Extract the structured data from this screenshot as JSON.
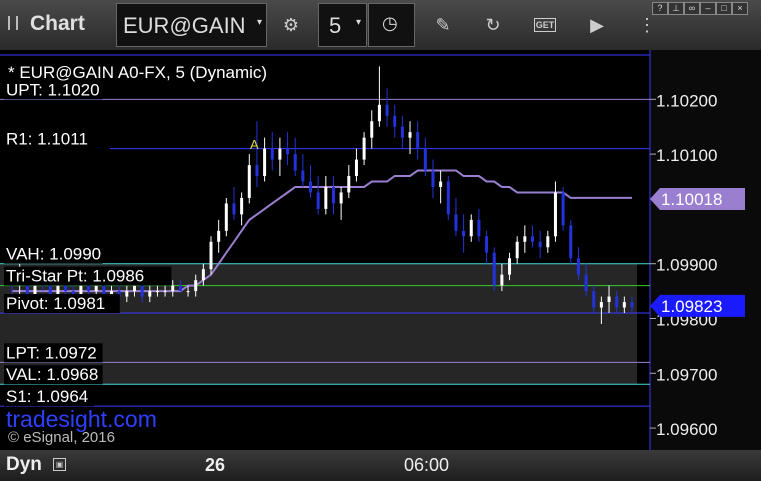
{
  "toolbar": {
    "title": "Chart",
    "symbol": "EUR@GAIN",
    "interval": "5"
  },
  "chart_header": "* EUR@GAIN A0-FX, 5 (Dynamic)",
  "watermark": "tradesight.com",
  "copyright": "© eSignal, 2016",
  "bottom": {
    "mode": "Dyn",
    "x_labels": [
      "26",
      "06:00"
    ]
  },
  "colors": {
    "background": "#000000",
    "up_candle": "#ffffff",
    "down_candle": "#2233dd",
    "moving_average": "#9a7fd0",
    "level_purple": "#9a7fd0",
    "level_blue": "#3a3aff",
    "level_cyan": "#48d8d8",
    "level_green": "#33cc33",
    "last_price_badge": "#1a1aff",
    "ma_price_badge": "#9a7fd0"
  },
  "chart_data": {
    "type": "candlestick",
    "ylim": [
      1.0956,
      1.1029
    ],
    "y_ticks": [
      "1.10200",
      "1.10100",
      "1.09900",
      "1.09800",
      "1.09700",
      "1.09600"
    ],
    "y_tick_values": [
      1.102,
      1.101,
      1.099,
      1.098,
      1.097,
      1.096
    ],
    "levels": [
      {
        "label": "UPT: 1.1020",
        "value": 1.102,
        "color": "purple"
      },
      {
        "label": "R1: 1.1011",
        "value": 1.1011,
        "color": "blue"
      },
      {
        "label": "VAH: 1.0990",
        "value": 1.099,
        "color": "cyan"
      },
      {
        "label": "Tri-Star Pt: 1.0986",
        "value": 1.0986,
        "color": "green"
      },
      {
        "label": "Pivot: 1.0981",
        "value": 1.0981,
        "color": "blue"
      },
      {
        "label": "LPT: 1.0972",
        "value": 1.0972,
        "color": "purple"
      },
      {
        "label": "VAL: 1.0968",
        "value": 1.0968,
        "color": "cyan"
      },
      {
        "label": "S1: 1.0964",
        "value": 1.0964,
        "color": "blue"
      }
    ],
    "value_area": [
      1.0968,
      1.099
    ],
    "annotation": "A",
    "last_price": "1.09823",
    "ma_price": "1.10018",
    "candles": [
      [
        1.0987,
        1.0989,
        1.0984,
        1.0986
      ],
      [
        1.0986,
        1.099,
        1.0983,
        1.0988
      ],
      [
        1.0988,
        1.0989,
        1.0982,
        1.0984
      ],
      [
        1.0984,
        1.0988,
        1.0983,
        1.0987
      ],
      [
        1.0987,
        1.0989,
        1.0985,
        1.0986
      ],
      [
        1.0986,
        1.0987,
        1.0983,
        1.0984
      ],
      [
        1.0984,
        1.0987,
        1.0983,
        1.0986
      ],
      [
        1.0986,
        1.0988,
        1.0984,
        1.0985
      ],
      [
        1.0985,
        1.0986,
        1.0982,
        1.0983
      ],
      [
        1.0983,
        1.0987,
        1.0982,
        1.0986
      ],
      [
        1.0986,
        1.0987,
        1.0984,
        1.0985
      ],
      [
        1.0985,
        1.0987,
        1.0984,
        1.0986
      ],
      [
        1.0986,
        1.0987,
        1.0983,
        1.0984
      ],
      [
        1.0984,
        1.0986,
        1.0983,
        1.0985
      ],
      [
        1.0985,
        1.0986,
        1.0983,
        1.0984
      ],
      [
        1.0984,
        1.0986,
        1.0983,
        1.0985
      ],
      [
        1.0985,
        1.0987,
        1.0984,
        1.0986
      ],
      [
        1.0986,
        1.0987,
        1.0983,
        1.0984
      ],
      [
        1.0984,
        1.0986,
        1.0983,
        1.0985
      ],
      [
        1.0985,
        1.0986,
        1.0984,
        1.0985
      ],
      [
        1.0985,
        1.0986,
        1.0984,
        1.0985
      ],
      [
        1.0985,
        1.0987,
        1.0984,
        1.0986
      ],
      [
        1.0986,
        1.0987,
        1.0985,
        1.0985
      ],
      [
        1.0985,
        1.0986,
        1.0984,
        1.0985
      ],
      [
        1.0985,
        1.0988,
        1.0984,
        1.0987
      ],
      [
        1.0987,
        1.099,
        1.0986,
        1.0989
      ],
      [
        1.0989,
        1.0995,
        1.0988,
        1.0994
      ],
      [
        1.0994,
        1.0998,
        1.0992,
        1.0996
      ],
      [
        1.0996,
        1.1002,
        1.0995,
        1.1001
      ],
      [
        1.1001,
        1.1004,
        1.0998,
        1.0999
      ],
      [
        1.0999,
        1.1003,
        1.0997,
        1.1002
      ],
      [
        1.1002,
        1.101,
        1.1001,
        1.1008
      ],
      [
        1.1008,
        1.1016,
        1.1004,
        1.1006
      ],
      [
        1.1006,
        1.1013,
        1.1005,
        1.1011
      ],
      [
        1.1011,
        1.1014,
        1.1007,
        1.1009
      ],
      [
        1.1009,
        1.1013,
        1.1006,
        1.1011
      ],
      [
        1.1011,
        1.1014,
        1.1008,
        1.101
      ],
      [
        1.101,
        1.1013,
        1.1006,
        1.1007
      ],
      [
        1.1007,
        1.101,
        1.1004,
        1.1005
      ],
      [
        1.1005,
        1.1008,
        1.1002,
        1.1003
      ],
      [
        1.1003,
        1.1006,
        1.0999,
        1.1
      ],
      [
        1.1,
        1.1006,
        1.0999,
        1.1004
      ],
      [
        1.1004,
        1.1006,
        1.0999,
        1.1001
      ],
      [
        1.1001,
        1.1004,
        1.0998,
        1.1003
      ],
      [
        1.1003,
        1.1008,
        1.1002,
        1.1006
      ],
      [
        1.1006,
        1.1011,
        1.1005,
        1.1009
      ],
      [
        1.1009,
        1.1014,
        1.1008,
        1.1013
      ],
      [
        1.1013,
        1.1018,
        1.1011,
        1.1016
      ],
      [
        1.1016,
        1.1026,
        1.1015,
        1.1019
      ],
      [
        1.1019,
        1.1022,
        1.1015,
        1.1017
      ],
      [
        1.1017,
        1.1019,
        1.1013,
        1.1015
      ],
      [
        1.1015,
        1.1017,
        1.1011,
        1.1013
      ],
      [
        1.1013,
        1.1016,
        1.101,
        1.1014
      ],
      [
        1.1014,
        1.1016,
        1.1009,
        1.1011
      ],
      [
        1.1011,
        1.1013,
        1.1006,
        1.1007
      ],
      [
        1.1007,
        1.1009,
        1.1002,
        1.1004
      ],
      [
        1.1004,
        1.1007,
        1.1001,
        1.1005
      ],
      [
        1.1005,
        1.1006,
        1.0998,
        1.0999
      ],
      [
        1.0999,
        1.1002,
        1.0995,
        1.0996
      ],
      [
        1.0996,
        1.0999,
        1.0992,
        1.0995
      ],
      [
        1.0995,
        1.0999,
        1.0994,
        1.0998
      ],
      [
        1.0998,
        1.1,
        1.0994,
        1.0995
      ],
      [
        1.0995,
        1.0996,
        1.099,
        1.0992
      ],
      [
        1.0992,
        1.0993,
        1.0985,
        1.0986
      ],
      [
        1.0986,
        1.099,
        1.0985,
        1.0988
      ],
      [
        1.0988,
        1.0992,
        1.0987,
        1.0991
      ],
      [
        1.0991,
        1.0995,
        1.099,
        1.0994
      ],
      [
        1.0994,
        1.0997,
        1.0992,
        1.0995
      ],
      [
        1.0995,
        1.0997,
        1.0993,
        1.0994
      ],
      [
        1.0994,
        1.0996,
        1.0991,
        1.0993
      ],
      [
        1.0993,
        1.0996,
        1.0992,
        1.0995
      ],
      [
        1.0995,
        1.1005,
        1.0994,
        1.1003
      ],
      [
        1.1003,
        1.1004,
        1.0996,
        1.0997
      ],
      [
        1.0997,
        1.0998,
        1.099,
        1.0991
      ],
      [
        1.0991,
        1.0993,
        1.0987,
        1.0988
      ],
      [
        1.0988,
        1.099,
        1.0984,
        1.0985
      ],
      [
        1.0985,
        1.0986,
        1.0981,
        1.0982
      ],
      [
        1.0982,
        1.0984,
        1.0979,
        1.0983
      ],
      [
        1.0983,
        1.0986,
        1.0981,
        1.0984
      ],
      [
        1.0984,
        1.0985,
        1.0981,
        1.0982
      ],
      [
        1.0982,
        1.0984,
        1.0981,
        1.0983
      ],
      [
        1.0983,
        1.0984,
        1.0981,
        1.0982
      ]
    ],
    "moving_average": [
      1.0985,
      1.0985,
      1.0985,
      1.0985,
      1.0985,
      1.0985,
      1.0985,
      1.0985,
      1.0985,
      1.0985,
      1.0985,
      1.0985,
      1.0985,
      1.0985,
      1.0985,
      1.0985,
      1.0985,
      1.0985,
      1.0985,
      1.0985,
      1.0985,
      1.0985,
      1.0985,
      1.0986,
      1.0986,
      1.0987,
      1.0988,
      1.099,
      1.0992,
      1.0994,
      1.0996,
      1.0998,
      1.0999,
      1.1,
      1.1001,
      1.1002,
      1.1003,
      1.1004,
      1.1004,
      1.1004,
      1.1004,
      1.1004,
      1.1004,
      1.1004,
      1.1004,
      1.1004,
      1.1004,
      1.1005,
      1.1005,
      1.1005,
      1.1006,
      1.1006,
      1.1006,
      1.1007,
      1.1007,
      1.1007,
      1.1007,
      1.1007,
      1.1007,
      1.1006,
      1.1006,
      1.1006,
      1.1005,
      1.1005,
      1.1004,
      1.1004,
      1.1003,
      1.1003,
      1.1003,
      1.1003,
      1.1003,
      1.1003,
      1.1003,
      1.1002,
      1.1002,
      1.1002,
      1.1002,
      1.1002,
      1.1002,
      1.1002,
      1.1002,
      1.1002
    ]
  }
}
